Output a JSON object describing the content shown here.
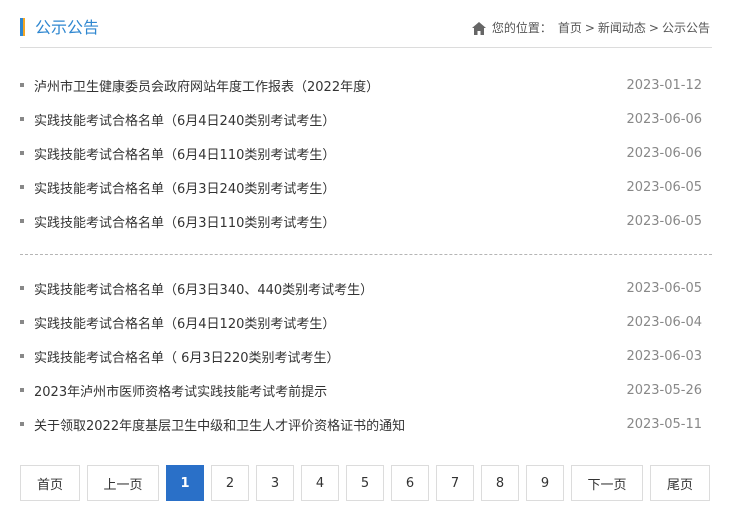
{
  "header": {
    "title": "公示公告",
    "crumb_label": "您的位置：",
    "crumb_items": [
      "首页",
      "新闻动态",
      "公示公告"
    ],
    "crumb_sep": ">"
  },
  "list_group_1": [
    {
      "title": "泸州市卫生健康委员会政府网站年度工作报表（2022年度）",
      "date": "2023-01-12"
    },
    {
      "title": "实践技能考试合格名单（6月4日240类别考试考生）",
      "date": "2023-06-06"
    },
    {
      "title": "实践技能考试合格名单（6月4日110类别考试考生）",
      "date": "2023-06-06"
    },
    {
      "title": "实践技能考试合格名单（6月3日240类别考试考生）",
      "date": "2023-06-05"
    },
    {
      "title": "实践技能考试合格名单（6月3日110类别考试考生）",
      "date": "2023-06-05"
    }
  ],
  "list_group_2": [
    {
      "title": "实践技能考试合格名单（6月3日340、440类别考试考生）",
      "date": "2023-06-05"
    },
    {
      "title": "实践技能考试合格名单（6月4日120类别考试考生）",
      "date": "2023-06-04"
    },
    {
      "title": "实践技能考试合格名单（ 6月3日220类别考试考生）",
      "date": "2023-06-03"
    },
    {
      "title": "2023年泸州市医师资格考试实践技能考试考前提示",
      "date": "2023-05-26"
    },
    {
      "title": "关于领取2022年度基层卫生中级和卫生人才评价资格证书的通知",
      "date": "2023-05-11"
    }
  ],
  "pagination": {
    "first": "首页",
    "prev": "上一页",
    "pages": [
      "1",
      "2",
      "3",
      "4",
      "5",
      "6",
      "7",
      "8",
      "9"
    ],
    "current": "1",
    "next": "下一页",
    "last": "尾页"
  },
  "icons": {
    "home": "home-icon"
  },
  "colors": {
    "accent": "#2f87d0",
    "active_page": "#2a70c8",
    "title_mark": "#f5a623"
  }
}
